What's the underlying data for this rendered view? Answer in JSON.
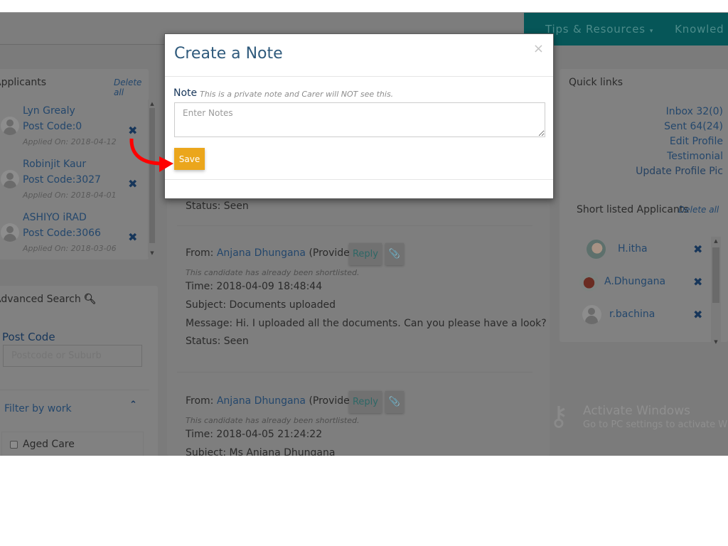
{
  "nav": {
    "items": [
      {
        "label": "Tips & Resources",
        "caret": "▾"
      },
      {
        "label": "Knowled"
      }
    ]
  },
  "applicants": {
    "title": "Applicants",
    "delete_all": "Delete all",
    "items": [
      {
        "name": "Lyn Grealy",
        "post_code": "Post Code:0",
        "applied_on": "Applied On: 2018-04-12"
      },
      {
        "name": "Robinjit Kaur",
        "post_code": "Post Code:3027",
        "applied_on": "Applied On: 2018-04-01"
      },
      {
        "name": "ASHIYO iRAD",
        "post_code": "Post Code:3066",
        "applied_on": "Applied On: 2018-03-06"
      }
    ],
    "remove_icon": "✖"
  },
  "advanced_search": {
    "title": "Advanced Search",
    "search_icon": "🔍︎",
    "post_code_label": "Post Code",
    "post_code_placeholder": "Postcode or Suburb",
    "filter_label": "Filter by work",
    "filter_chevron": "⌃",
    "filters": [
      {
        "label": "Aged Care",
        "checked": false
      }
    ]
  },
  "messages": [
    {
      "status": "Status: Seen"
    },
    {
      "from_prefix": "From: ",
      "from_name": "Anjana Dhungana",
      "from_role": " (Provider)",
      "reply_label": "Reply",
      "attach_icon": "📎",
      "note": "This candidate has already been shortlisted.",
      "time": "Time: 2018-04-09 18:48:44",
      "subject": "Subject: Documents uploaded",
      "message": "Message: Hi. I uploaded all the documents. Can you please have a look?",
      "status": "Status: Seen"
    },
    {
      "from_prefix": "From: ",
      "from_name": "Anjana Dhungana",
      "from_role": " (Provider)",
      "reply_label": "Reply",
      "attach_icon": "📎",
      "note": "This candidate has already been shortlisted.",
      "time": "Time: 2018-04-05 21:24:22",
      "subject": "Subject: Ms Anjana Dhungana"
    }
  ],
  "quick_links": {
    "title": "Quick links",
    "links": [
      "Inbox 32(0)",
      "Sent 64(24)",
      "Edit Profile",
      "Testimonial",
      "Update Profile Pic"
    ]
  },
  "shortlisted": {
    "title": "Short listed Applicants",
    "delete_all": "Delete all",
    "items": [
      {
        "name": "H.itha"
      },
      {
        "name": "A.Dhungana"
      },
      {
        "name": "r.bachina"
      }
    ]
  },
  "watermark": {
    "title": "Activate Windows",
    "subtitle": "Go to PC settings to activate Windows."
  },
  "modal": {
    "title": "Create a Note",
    "close_icon": "×",
    "note_label": "Note",
    "note_hint": "This is a private note and Carer will NOT see this.",
    "textarea_placeholder": "Enter Notes",
    "textarea_value": "",
    "save_label": "Save"
  },
  "colors": {
    "nav_teal": "#065658",
    "save_button": "#eba61c",
    "modal_title": "#2f5a7c",
    "annotation_arrow": "#ff0000"
  }
}
